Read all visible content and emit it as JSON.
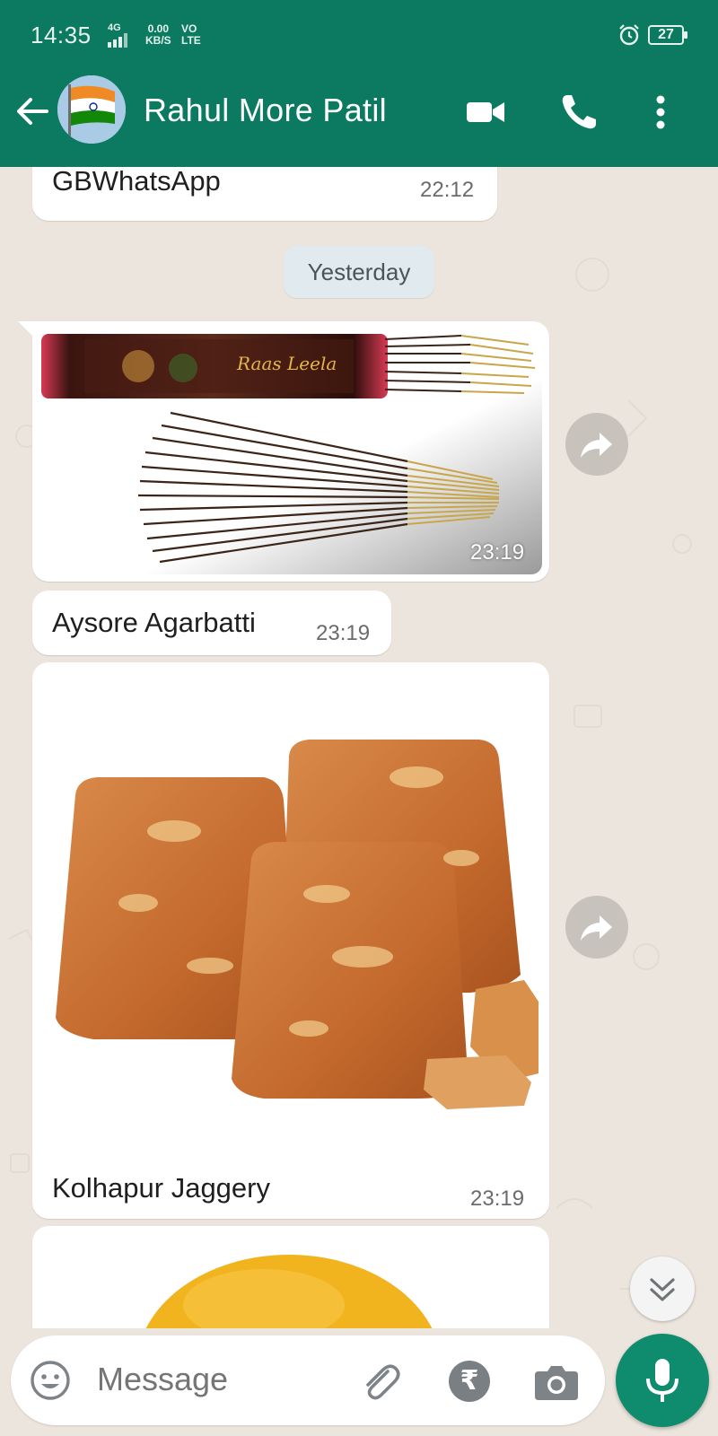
{
  "status_bar": {
    "time": "14:35",
    "network": "4G",
    "speed_value": "0.00",
    "speed_unit": "KB/S",
    "volte_top": "VO",
    "volte_bottom": "LTE",
    "battery": "27"
  },
  "header": {
    "contact_name": "Rahul More Patil",
    "icons": [
      "back-arrow-icon",
      "video-call-icon",
      "voice-call-icon",
      "more-options-icon"
    ]
  },
  "chat": {
    "messages": [
      {
        "type": "text",
        "text": "GBWhatsApp",
        "time": "22:12"
      },
      {
        "type": "date",
        "text": "Yesterday"
      },
      {
        "type": "image",
        "image": "incense-sticks-pack",
        "packet_text": "Raas Leela",
        "time": "23:19"
      },
      {
        "type": "text",
        "text": "Aysore Agarbatti",
        "time": "23:19"
      },
      {
        "type": "image",
        "image": "jaggery-blocks",
        "caption": "Kolhapur Jaggery",
        "time": "23:19"
      },
      {
        "type": "image",
        "image": "partial-yellow-item"
      }
    ]
  },
  "input": {
    "placeholder": "Message",
    "icons": [
      "emoji-icon",
      "attach-icon",
      "rupee-icon",
      "camera-icon",
      "mic-icon"
    ],
    "rupee_symbol": "₹"
  },
  "colors": {
    "header": "#0b7a60",
    "chat_background": "#ece5dd",
    "bubble": "#ffffff",
    "mic_button": "#0f8b6d"
  }
}
